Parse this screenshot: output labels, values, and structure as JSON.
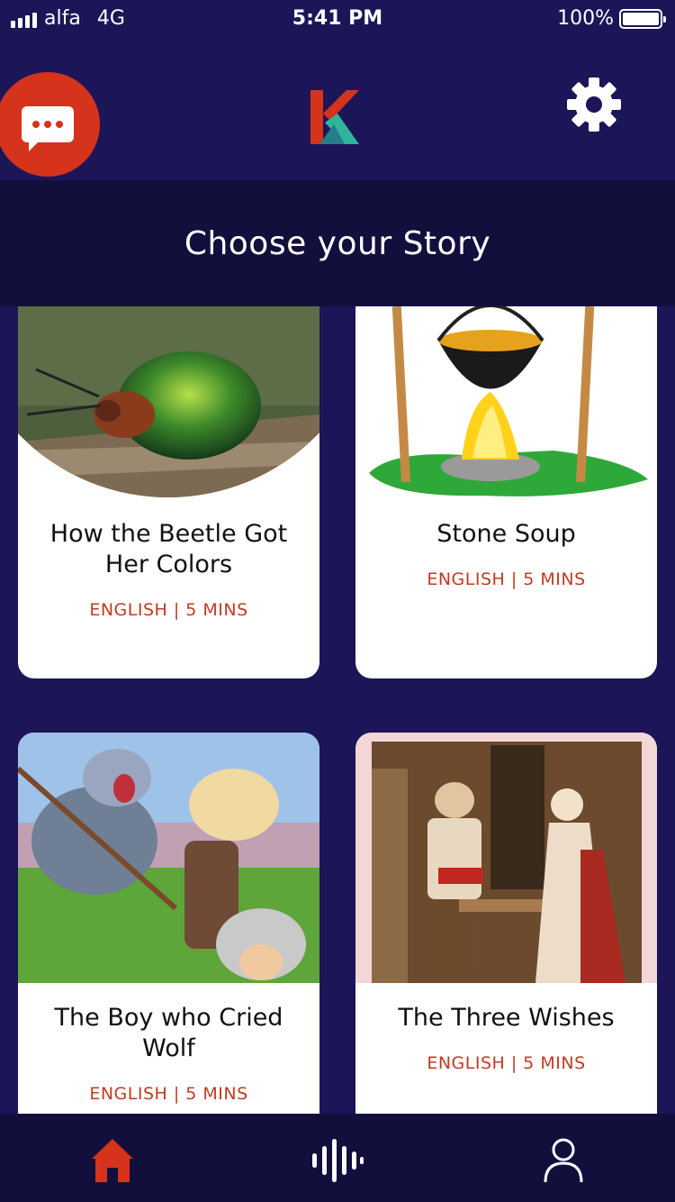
{
  "status": {
    "carrier": "alfa",
    "network": "4G",
    "time": "5:41 PM",
    "battery": "100%"
  },
  "header": {
    "logo_letter": "K",
    "icons": [
      "chat-icon",
      "gear-icon"
    ]
  },
  "page_title": "Choose your Story",
  "stories": [
    {
      "title": "How the Beetle Got Her Colors",
      "meta": "ENGLISH | 5 MINS"
    },
    {
      "title": "Stone Soup",
      "meta": "ENGLISH | 5 MINS"
    },
    {
      "title": "The Boy who Cried Wolf",
      "meta": "ENGLISH | 5 MINS"
    },
    {
      "title": "The Three Wishes",
      "meta": "ENGLISH | 5 MINS"
    }
  ],
  "nav": {
    "items": [
      "home-icon",
      "audio-icon",
      "profile-icon"
    ],
    "active_color": "#d5331c"
  },
  "colors": {
    "background": "#1c1658",
    "accent": "#d5331c",
    "meta_text": "#c33a22"
  }
}
